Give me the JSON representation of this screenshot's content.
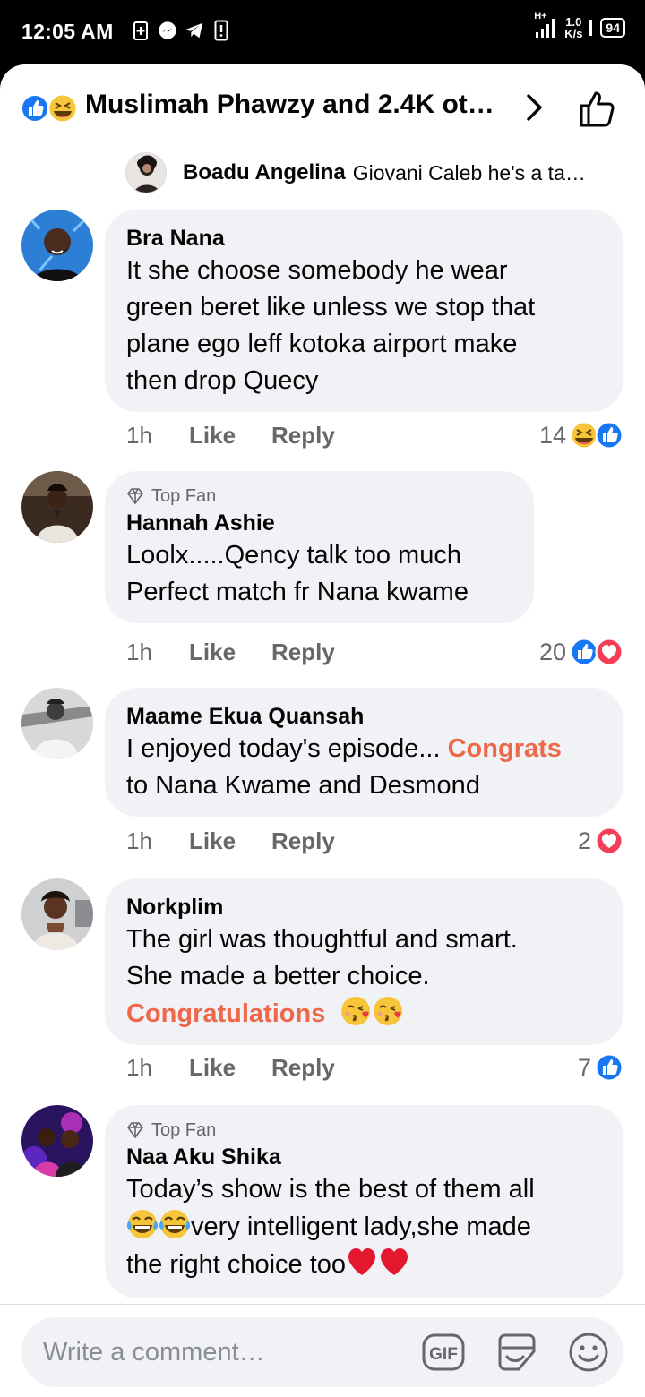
{
  "status_bar": {
    "time": "12:05 AM",
    "network_type": "H+",
    "speed_value": "1.0",
    "speed_unit": "K/s",
    "battery": "94"
  },
  "header": {
    "title": "Muslimah Phawzy and 2.4K ot…"
  },
  "reply_preview": {
    "name": "Boadu Angelina",
    "text": "Giovani Caleb he's a ta…"
  },
  "comments": [
    {
      "name": "Bra Nana",
      "top_fan": false,
      "lines": [
        "It she choose somebody he wear",
        "green beret like unless we stop that",
        "plane ego leff  kotoka airport make",
        "then drop Quecy"
      ],
      "time": "1h",
      "like": "Like",
      "reply": "Reply",
      "reaction_count": "14",
      "reactions": [
        "haha",
        "like"
      ]
    },
    {
      "name": "Hannah Ashie",
      "top_fan": true,
      "badge": "Top Fan",
      "lines": [
        "Loolx.....Qency talk too much",
        "Perfect match fr Nana kwame"
      ],
      "time": "1h",
      "like": "Like",
      "reply": "Reply",
      "reaction_count": "20",
      "reactions": [
        "like",
        "love"
      ]
    },
    {
      "name": "Maame Ekua Quansah",
      "top_fan": false,
      "line1_text": "I enjoyed today's episode... ",
      "line1_highlight": "Congrats",
      "line2": "to Nana Kwame and Desmond",
      "time": "1h",
      "like": "Like",
      "reply": "Reply",
      "reaction_count": "2",
      "reactions": [
        "love"
      ]
    },
    {
      "name": "Norkplim",
      "top_fan": false,
      "line1": "The girl was thoughtful and smart.",
      "line2": "She made a better choice.",
      "highlight": "Congratulations",
      "emojis": [
        "kiss-emoji",
        "kiss-emoji"
      ],
      "time": "1h",
      "like": "Like",
      "reply": "Reply",
      "reaction_count": "7",
      "reactions": [
        "like"
      ]
    },
    {
      "name": "Naa Aku Shika",
      "top_fan": true,
      "badge": "Top Fan",
      "line1": "Today’s show is the best of them all",
      "line2": "very intelligent lady,she made",
      "line3": "the right choice too",
      "emojis": [
        "tears-of-joy-emoji",
        "tears-of-joy-emoji",
        "red-heart-emoji",
        "red-heart-emoji"
      ]
    }
  ],
  "composer": {
    "placeholder": "Write a comment…",
    "gif_label": "GIF"
  },
  "colors": {
    "highlight": "#f0684a",
    "bubble": "#f0f2f5",
    "like_blue": "#1877f2",
    "love_red": "#f33e58",
    "muted": "#65676b"
  }
}
